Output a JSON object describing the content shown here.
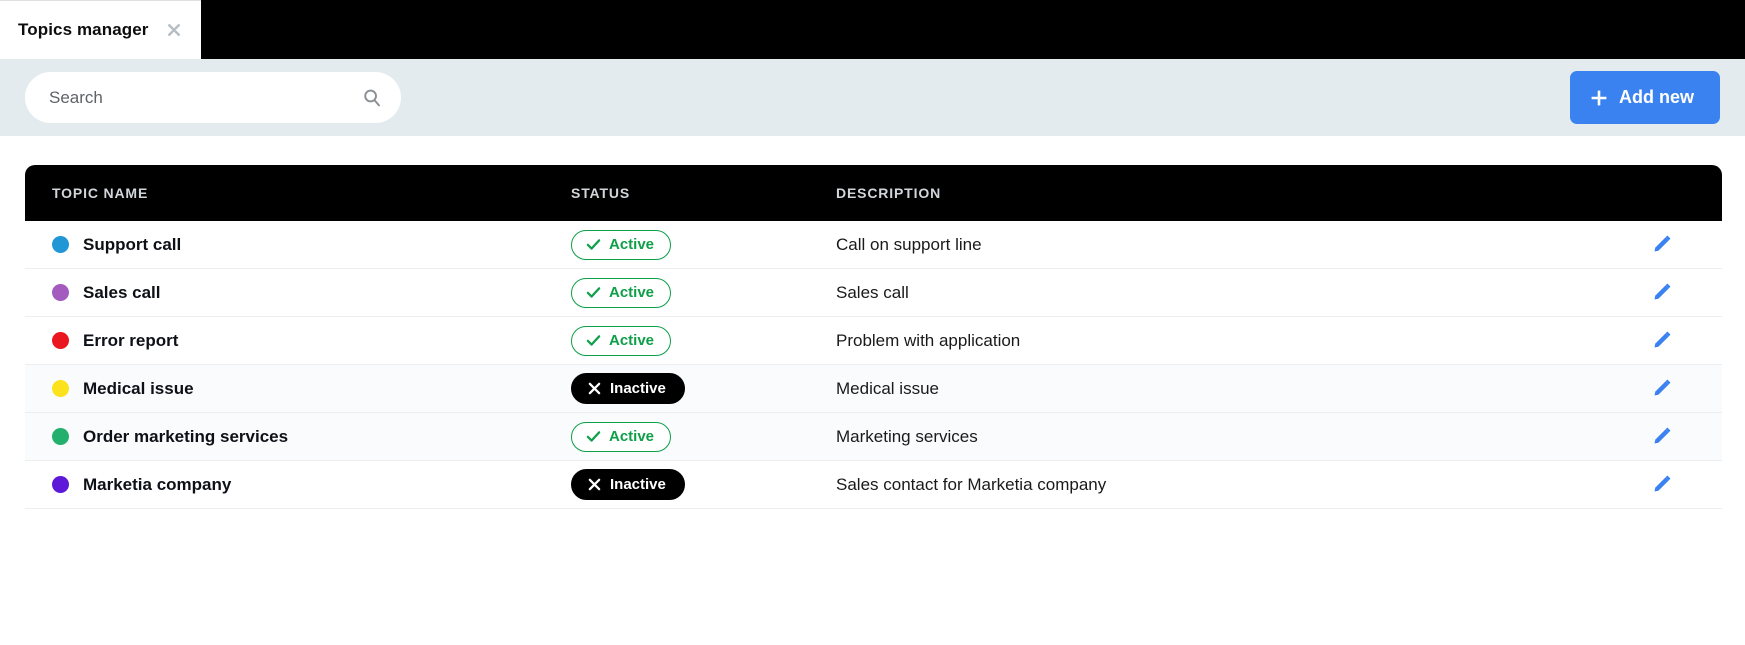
{
  "tab": {
    "title": "Topics manager",
    "close_icon": "close-icon"
  },
  "toolbar": {
    "search_placeholder": "Search",
    "search_value": "",
    "search_icon": "search-icon",
    "add_new_label": "Add new",
    "add_new_icon": "plus-icon",
    "accent_color": "#3b82f1",
    "background_color": "#e3ebef"
  },
  "table": {
    "columns": [
      "TOPIC NAME",
      "STATUS",
      "DESCRIPTION"
    ],
    "header_background": "#000000",
    "rows": [
      {
        "color": "#2196d6",
        "name": "Support call",
        "status": "Active",
        "status_type": "active",
        "description": "Call on support line",
        "edit_icon": "pencil-icon",
        "tinted": false
      },
      {
        "color": "#a35bc0",
        "name": "Sales call",
        "status": "Active",
        "status_type": "active",
        "description": "Sales call",
        "edit_icon": "pencil-icon",
        "tinted": false
      },
      {
        "color": "#ea1620",
        "name": "Error report",
        "status": "Active",
        "status_type": "active",
        "description": "Problem with application",
        "edit_icon": "pencil-icon",
        "tinted": false
      },
      {
        "color": "#fbe21c",
        "name": "Medical issue",
        "status": "Inactive",
        "status_type": "inactive",
        "description": "Medical issue",
        "edit_icon": "pencil-icon",
        "tinted": true
      },
      {
        "color": "#23b06c",
        "name": "Order marketing services",
        "status": "Active",
        "status_type": "active",
        "description": "Marketing services",
        "edit_icon": "pencil-icon",
        "tinted": true
      },
      {
        "color": "#5d18d8",
        "name": "Marketia company",
        "status": "Inactive",
        "status_type": "inactive",
        "description": "Sales contact for Marketia company",
        "edit_icon": "pencil-icon",
        "tinted": false
      }
    ],
    "status_colors": {
      "active": "#0e9f49",
      "inactive": "#000000"
    }
  }
}
